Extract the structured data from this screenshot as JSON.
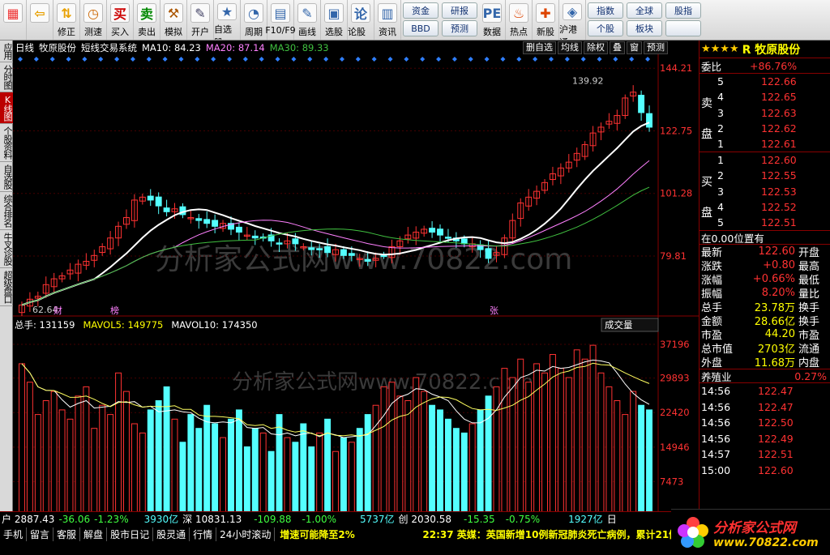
{
  "toolbar": {
    "buttons": [
      {
        "name": "home-button",
        "icon": "grid-icon",
        "label": ""
      },
      {
        "name": "back-button",
        "icon": "back-arrow-icon",
        "label": ""
      },
      {
        "name": "fix-button",
        "icon": "updown-icon",
        "label": "修正"
      },
      {
        "name": "test-button",
        "icon": "clock-icon",
        "label": "测速"
      },
      {
        "name": "buy-button",
        "icon": "buy-icon",
        "label": "买入",
        "glyph": "买"
      },
      {
        "name": "sell-button",
        "icon": "sell-icon",
        "label": "卖出",
        "glyph": "卖"
      },
      {
        "name": "sim-button",
        "icon": "hammer-icon",
        "label": "模拟"
      },
      {
        "name": "open-button",
        "icon": "account-icon",
        "label": "开户"
      },
      {
        "name": "watchlist-button",
        "icon": "star-icon",
        "label": "自选股"
      },
      {
        "name": "period-button",
        "icon": "period-icon",
        "label": "周期"
      },
      {
        "name": "f10-button",
        "icon": "f10-icon",
        "label": "F10/F9"
      },
      {
        "name": "draw-button",
        "icon": "pencil-icon",
        "label": "画线"
      },
      {
        "name": "select-button",
        "icon": "select-icon",
        "label": "选股"
      },
      {
        "name": "forum-button",
        "icon": "forum-icon",
        "label": "论股堂",
        "glyph": "论"
      },
      {
        "name": "news-button",
        "icon": "news-icon",
        "label": "资讯"
      }
    ],
    "pills1": [
      "资金",
      "BBD"
    ],
    "pills2": [
      "研报",
      "预测"
    ],
    "buttons2": [
      {
        "name": "data-button",
        "icon": "pe-icon",
        "label": "数据",
        "glyph": "PE"
      },
      {
        "name": "hot-button",
        "icon": "fire-icon",
        "label": "热点"
      },
      {
        "name": "ipo-button",
        "icon": "new-icon",
        "label": "新股"
      },
      {
        "name": "hk-button",
        "icon": "hk-icon",
        "label": "沪港通"
      }
    ],
    "pills3": [
      "指数",
      "个股"
    ],
    "pills4": [
      "全球",
      "板块"
    ],
    "pills5": [
      "股指",
      ""
    ]
  },
  "left_tabs": [
    {
      "label": "应用",
      "active": false
    },
    {
      "label": "分时图",
      "active": false
    },
    {
      "label": "K线图",
      "active": true
    },
    {
      "label": "个股资料",
      "active": false
    },
    {
      "label": "自选股",
      "active": false
    },
    {
      "label": "综合排名",
      "active": false
    },
    {
      "label": "牛叉诊股",
      "active": false
    },
    {
      "label": "超级盘口",
      "active": false
    }
  ],
  "kline_header": {
    "period": "日线",
    "stock": "牧原股份",
    "system": "短线交易系统",
    "ma10": "MA10: 84.23",
    "ma20": "MA20: 87.14",
    "ma30": "MA30: 89.33",
    "tools": [
      "删自选",
      "均线",
      "除权",
      "叠",
      "窗",
      "预测"
    ]
  },
  "price_axis": [
    "144.21",
    "122.75",
    "101.28",
    "79.81"
  ],
  "annotations": {
    "high": "139.92",
    "low": "62.64",
    "marks": [
      "财",
      "榜",
      "张"
    ]
  },
  "volume_header": {
    "total": "总手: 131159",
    "mavol5": "MAVOL5: 149775",
    "mavol10": "MAVOL10: 174350",
    "selector": "成交量"
  },
  "volume_axis": [
    "37196",
    "29893",
    "22420",
    "14946",
    "7473",
    "X10"
  ],
  "watermark": "分析家公式网www.70822.com",
  "colors": {
    "up": "#ff3232",
    "down": "#54ffff",
    "ma10": "#ffffff",
    "ma20": "#ff80ff",
    "ma30": "#40c040",
    "yellow": "#ffff00",
    "red": "#ff3232"
  },
  "chart_data": {
    "type": "candlestick",
    "ylim": [
      62.64,
      144.21
    ],
    "closes": [
      63,
      65,
      66,
      70,
      72,
      73,
      75,
      77,
      78,
      80,
      83,
      86,
      90,
      93,
      99,
      100,
      99,
      97,
      95,
      96,
      94,
      93,
      92,
      91,
      90,
      91,
      89,
      88,
      87,
      86,
      86,
      85,
      84,
      85,
      84,
      83,
      82,
      82,
      81,
      82,
      80,
      80,
      79,
      78,
      79,
      80,
      83,
      85,
      87,
      88,
      89,
      88,
      87,
      86,
      85,
      84,
      84,
      82,
      79,
      81,
      86,
      92,
      98,
      100,
      102,
      105,
      108,
      110,
      112,
      115,
      118,
      122,
      124,
      126,
      128,
      134,
      136,
      129,
      124
    ]
  },
  "volume_data": {
    "ylim": [
      0,
      37196
    ],
    "values": [
      33000,
      29000,
      22000,
      25000,
      27000,
      23000,
      21000,
      26000,
      28000,
      19000,
      24000,
      22000,
      31000,
      27000,
      20000,
      18000,
      23000,
      25000,
      28000,
      21000,
      16000,
      22000,
      19000,
      24000,
      20000,
      17000,
      21000,
      23000,
      15000,
      19000,
      18000,
      14000,
      22000,
      17000,
      16000,
      20000,
      15000,
      18000,
      21000,
      14000,
      17000,
      16000,
      19000,
      22000,
      24000,
      28000,
      29000,
      26000,
      25000,
      30000,
      27000,
      24000,
      23000,
      21000,
      19000,
      18000,
      20000,
      23000,
      26000,
      28000,
      32000,
      30000,
      34000,
      29000,
      33000,
      31000,
      35000,
      32000,
      30000,
      36000,
      34000,
      37000,
      31000,
      28000,
      25000,
      22000,
      27000,
      24000,
      23000
    ]
  },
  "right_panel": {
    "title": "R 牧原股份",
    "stars": "★★★★",
    "weibi_label": "委比",
    "weibi": "+86.76%",
    "sell_label": "卖盘",
    "sells": [
      {
        "n": "5",
        "p": "122.66"
      },
      {
        "n": "4",
        "p": "122.65"
      },
      {
        "n": "3",
        "p": "122.63"
      },
      {
        "n": "2",
        "p": "122.62"
      },
      {
        "n": "1",
        "p": "122.61"
      }
    ],
    "buy_label": "买盘",
    "buys": [
      {
        "n": "1",
        "p": "122.60"
      },
      {
        "n": "2",
        "p": "122.55"
      },
      {
        "n": "3",
        "p": "122.53"
      },
      {
        "n": "4",
        "p": "122.52"
      },
      {
        "n": "5",
        "p": "122.51"
      }
    ],
    "position": "在0.00位置有",
    "stats": [
      {
        "k": "最新",
        "v": "122.60",
        "k2": "开盘"
      },
      {
        "k": "涨跌",
        "v": "+0.80",
        "k2": "最高"
      },
      {
        "k": "涨幅",
        "v": "+0.66%",
        "k2": "最低"
      },
      {
        "k": "振幅",
        "v": "8.20%",
        "k2": "量比"
      },
      {
        "k": "总手",
        "v": "23.78万",
        "k2": "换手"
      },
      {
        "k": "金额",
        "v": "28.66亿",
        "k2": "换手"
      },
      {
        "k": "市盈",
        "v": "44.20",
        "k2": "市盈"
      },
      {
        "k": "总市值",
        "v": "2703亿",
        "k2": "流通"
      },
      {
        "k": "外盘",
        "v": "11.68万",
        "k2": "内盘"
      }
    ],
    "sector": "养殖业",
    "sector_pct": "0.27%",
    "ticks": [
      {
        "t": "14:56",
        "p": "122.47"
      },
      {
        "t": "14:56",
        "p": "122.47"
      },
      {
        "t": "14:56",
        "p": "122.50"
      },
      {
        "t": "14:56",
        "p": "122.49"
      },
      {
        "t": "14:57",
        "p": "122.51"
      },
      {
        "t": "15:00",
        "p": "122.60"
      }
    ],
    "tabs": [
      "细",
      "诊",
      "分",
      "笔",
      "价"
    ]
  },
  "status_bar": {
    "sh": "户 2887.43",
    "sh_chg": "-36.06",
    "sh_pct": "-1.23%",
    "sh_amt": "3930亿",
    "sz": "深 10831.13",
    "sz_chg": "-109.88",
    "sz_pct": "-1.00%",
    "sz_amt": "5737亿",
    "cy": "创 2030.58",
    "cy_chg": "-15.35",
    "cy_pct": "-0.75%",
    "cy_amt": "1927亿",
    "tail": "日"
  },
  "bottom_tabs": [
    "手机",
    "留言",
    "客服",
    "解盘",
    "股市日记",
    "股灵通",
    "行情",
    "24小时滚动"
  ],
  "news1": "增速可能降至2%",
  "news2": "22:37 英媒：英国新增10例新冠肺炎死亡病例，累计21例",
  "logo": {
    "brand": "分析家公式网",
    "url": "www.70822.com"
  }
}
